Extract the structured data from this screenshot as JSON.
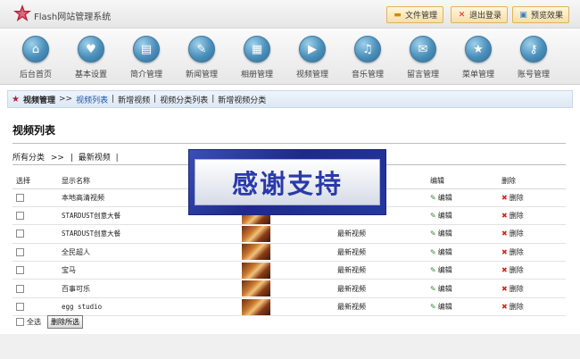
{
  "app": {
    "title": "Flash网站管理系统"
  },
  "toolbar": {
    "file_manage": "文件管理",
    "logout": "退出登录",
    "preview": "预览效果"
  },
  "nav": [
    {
      "label": "后台首页",
      "icon": "home"
    },
    {
      "label": "基本设置",
      "icon": "heart"
    },
    {
      "label": "简介管理",
      "icon": "document"
    },
    {
      "label": "新闻管理",
      "icon": "news"
    },
    {
      "label": "相册管理",
      "icon": "album"
    },
    {
      "label": "视频管理",
      "icon": "video"
    },
    {
      "label": "音乐管理",
      "icon": "music"
    },
    {
      "label": "留言管理",
      "icon": "mail"
    },
    {
      "label": "菜单管理",
      "icon": "star"
    },
    {
      "label": "账号管理",
      "icon": "key"
    }
  ],
  "breadcrumb": {
    "section": "视频管理",
    "sep": ">>",
    "links": [
      "视频列表",
      "新增视频",
      "视频分类列表",
      "新增视频分类"
    ]
  },
  "page": {
    "title": "视频列表",
    "filter_all": "所有分类",
    "filter_sep": ">>",
    "filter_current": "最新视频"
  },
  "table": {
    "headers": [
      "选择",
      "显示名称",
      "",
      "",
      "编辑",
      "删除"
    ],
    "rows": [
      {
        "name": "本地高清视频",
        "category": "",
        "edit": "编辑",
        "delete": "删除"
      },
      {
        "name": "STARDUST创意大餐",
        "category": "",
        "edit": "编辑",
        "delete": "删除"
      },
      {
        "name": "STARDUST创意大餐",
        "category": "最新视频",
        "edit": "编辑",
        "delete": "删除"
      },
      {
        "name": "全民超人",
        "category": "最新视频",
        "edit": "编辑",
        "delete": "删除"
      },
      {
        "name": "宝马",
        "category": "最新视频",
        "edit": "编辑",
        "delete": "删除"
      },
      {
        "name": "百事可乐",
        "category": "最新视频",
        "edit": "编辑",
        "delete": "删除"
      },
      {
        "name": "egg studio",
        "category": "最新视频",
        "edit": "编辑",
        "delete": "删除"
      }
    ]
  },
  "footer": {
    "select_all": "全选",
    "delete_selected": "删除所选"
  },
  "overlay": {
    "text": "感谢支持"
  },
  "colors": {
    "accent": "#1a56a8",
    "brand_red": "#b0203a",
    "nav_icon": "#4a8fba"
  }
}
